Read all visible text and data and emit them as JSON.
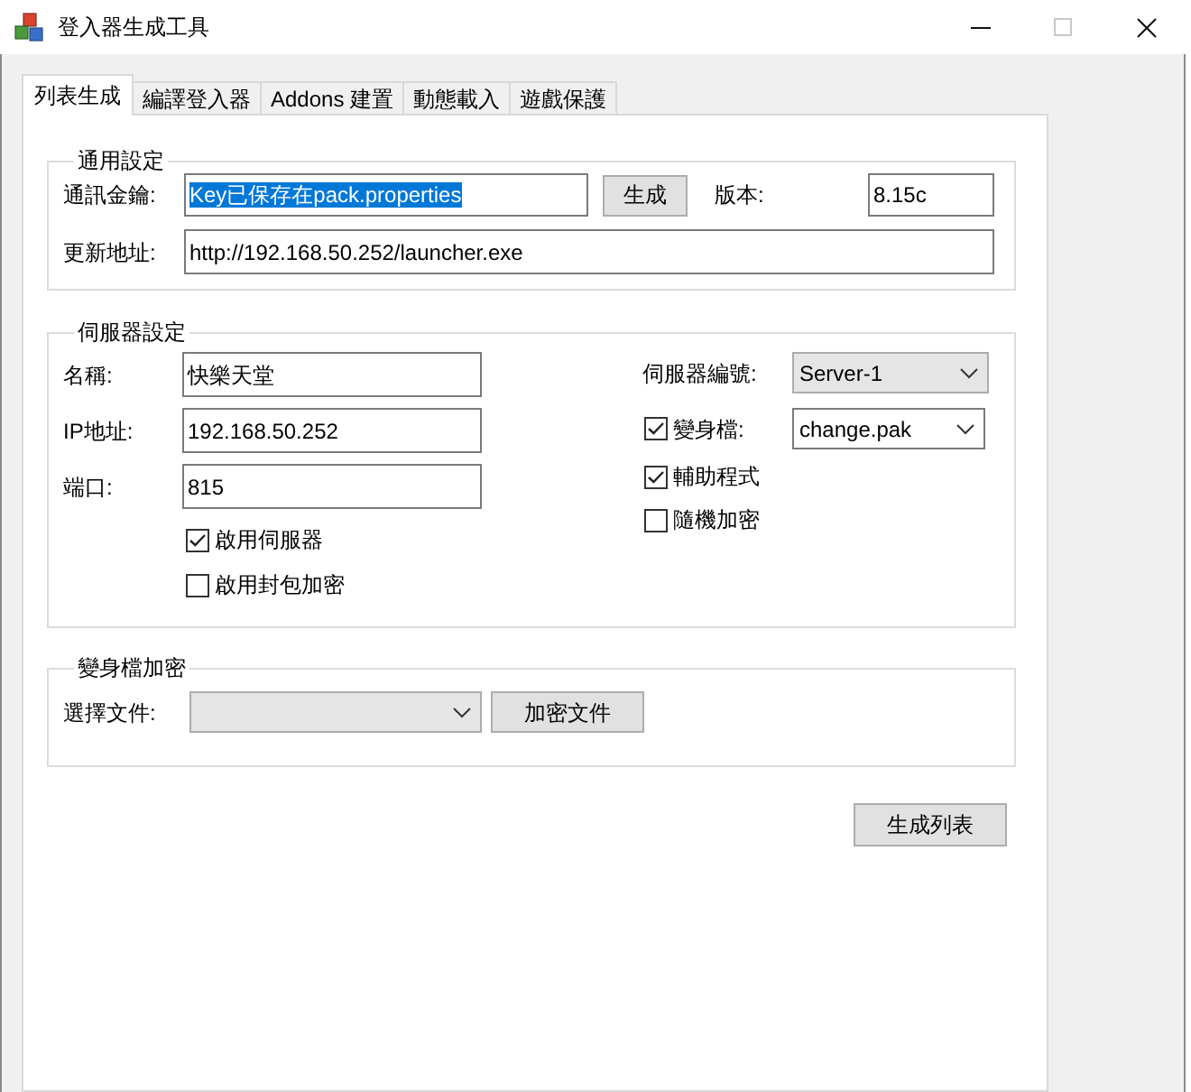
{
  "window": {
    "title": "登入器生成工具",
    "controls": [
      {
        "kind": "minimize",
        "disabled": false
      },
      {
        "kind": "maximize",
        "disabled": true
      },
      {
        "kind": "close",
        "disabled": false
      }
    ]
  },
  "tabs": [
    {
      "label": "列表生成",
      "selected": true
    },
    {
      "label": "編譯登入器",
      "selected": false
    },
    {
      "label": "Addons 建置",
      "selected": false
    },
    {
      "label": "動態載入",
      "selected": false
    },
    {
      "label": "遊戲保護",
      "selected": false
    }
  ],
  "general_settings": {
    "title": "通用設定",
    "key": {
      "label": "通訊金鑰:",
      "value": "Key已保存在pack.properties",
      "text_highlighted": true
    },
    "generate_button": "生成",
    "version": {
      "label": "版本:",
      "value": "8.15c"
    },
    "update_url": {
      "label": "更新地址:",
      "value": "http://192.168.50.252/launcher.exe"
    }
  },
  "server_settings": {
    "title": "伺服器設定",
    "fields": [
      {
        "label": "名稱:",
        "value": "快樂天堂"
      },
      {
        "label": "IP地址:",
        "value": "192.168.50.252"
      },
      {
        "label": "端口:",
        "value": "815"
      }
    ],
    "options": [
      {
        "label": "啟用伺服器",
        "checked": true
      },
      {
        "label": "啟用封包加密",
        "checked": false
      }
    ],
    "server_number": {
      "label": "伺服器編號:",
      "value": "Server-1",
      "editable": false
    },
    "morph_file": {
      "label": "變身檔:",
      "checked": true,
      "value": "change.pak",
      "editable": true
    },
    "extra_options": [
      {
        "label": "輔助程式",
        "checked": true
      },
      {
        "label": "隨機加密",
        "checked": false
      }
    ]
  },
  "morph_encryption": {
    "title": "變身檔加密",
    "file": {
      "label": "選擇文件:",
      "editable": false
    },
    "encrypt_button": "加密文件"
  },
  "generate_list_button": "生成列表"
}
